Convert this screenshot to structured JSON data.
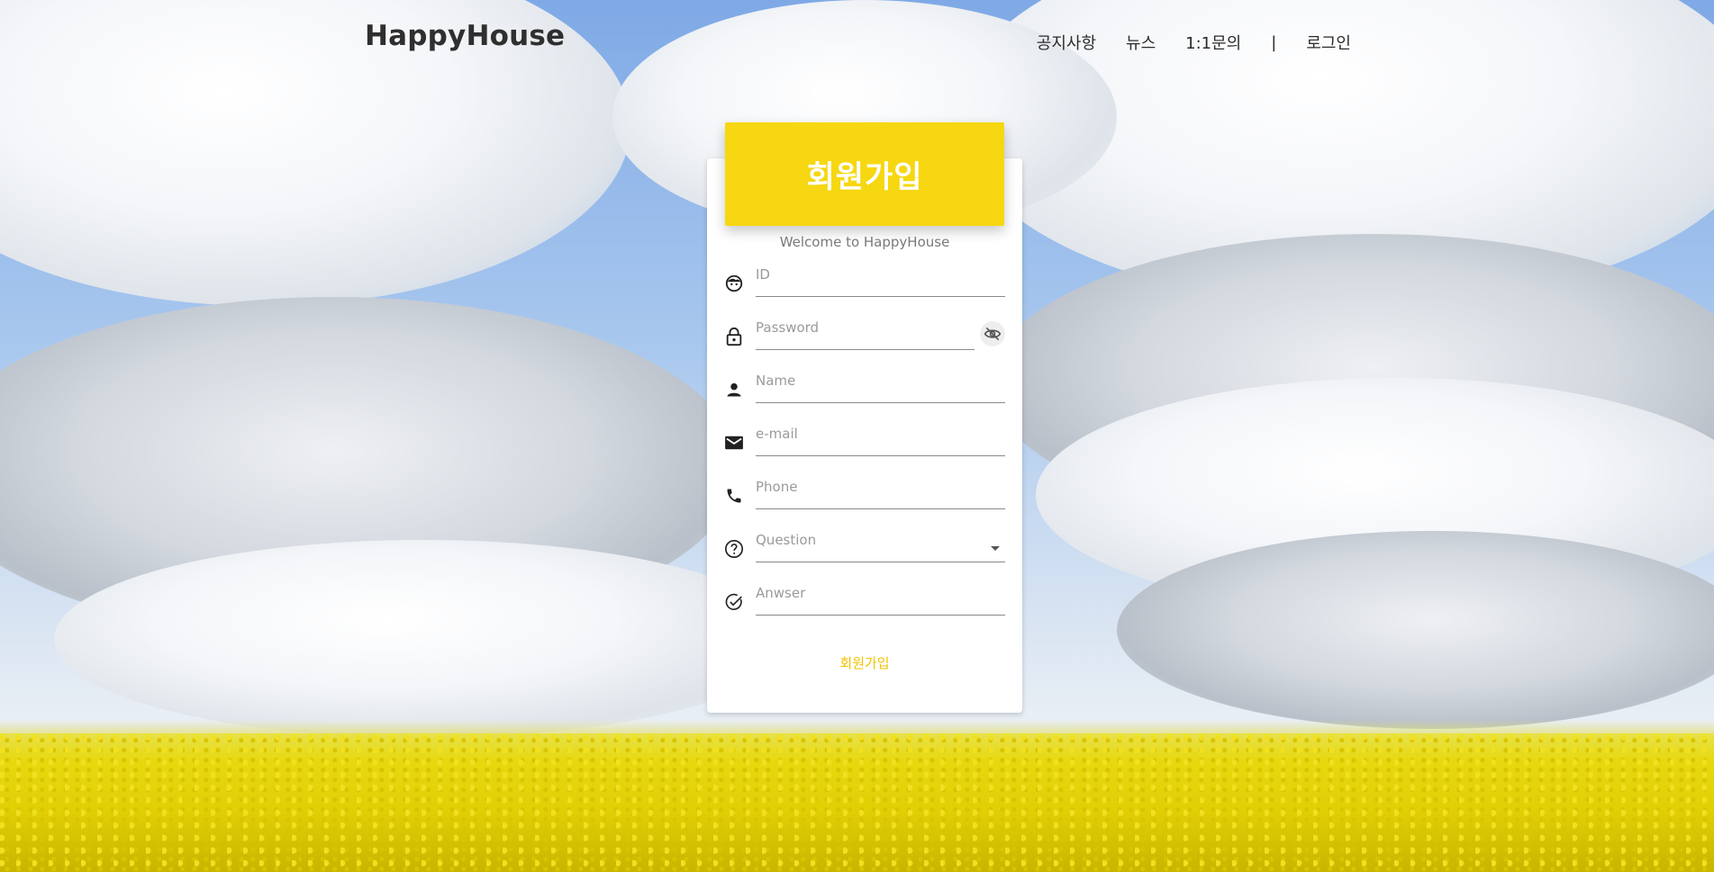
{
  "header": {
    "logo": "HappyHouse",
    "nav": [
      "공지사항",
      "뉴스",
      "1:1문의",
      "|",
      "로그인"
    ]
  },
  "form": {
    "title": "회원가입",
    "subtitle": "Welcome to HappyHouse",
    "fields": {
      "id": {
        "placeholder": "ID",
        "icon": "face-icon"
      },
      "password": {
        "placeholder": "Password",
        "icon": "lock-icon"
      },
      "name": {
        "placeholder": "Name",
        "icon": "person-icon"
      },
      "email": {
        "placeholder": "e-mail",
        "icon": "mail-icon"
      },
      "phone": {
        "placeholder": "Phone",
        "icon": "phone-icon"
      },
      "question": {
        "placeholder": "Question",
        "icon": "help-circle-icon"
      },
      "answer": {
        "placeholder": "Anwser",
        "icon": "check-circle-icon"
      }
    },
    "submit_label": "회원가입"
  },
  "colors": {
    "accent": "#f6d711",
    "submit_text": "#f2c200"
  }
}
